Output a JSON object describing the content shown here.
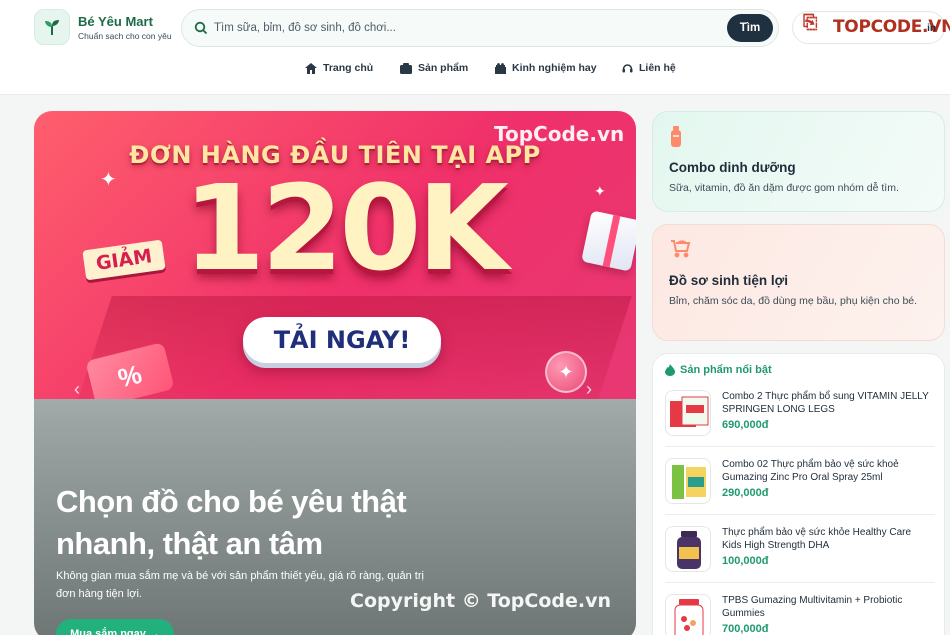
{
  "header": {
    "brand_name": "Bé Yêu Mart",
    "brand_tagline": "Chuẩn sạch cho con yêu",
    "search_placeholder": "Tìm sữa, bỉm, đồ sơ sinh, đồ chơi...",
    "search_button": "Tìm",
    "account_watermark_mark": "⎘",
    "account_watermark": "TOPCODE.VN",
    "account_label": "in"
  },
  "nav": [
    {
      "label": "Trang chủ",
      "icon": "home-icon"
    },
    {
      "label": "Sản phẩm",
      "icon": "box-icon"
    },
    {
      "label": "Kinh nghiệm hay",
      "icon": "gift-icon"
    },
    {
      "label": "Liên hệ",
      "icon": "headset-icon"
    }
  ],
  "banner": {
    "headline": "ĐƠN HÀNG ĐẦU TIÊN TẠI APP",
    "discount_tag": "GIẢM",
    "amount": "120K",
    "cta": "TẢI NGAY!",
    "watermark": "TopCode.vn",
    "percent_symbol": "%"
  },
  "hero": {
    "title": "Chọn đồ cho bé yêu thật nhanh, thật an tâm",
    "description": "Không gian mua sắm mẹ và bé với sản phẩm thiết yếu, giá rõ ràng, quản trị đơn hàng tiện lợi.",
    "button": "Mua sắm ngay →",
    "watermark": "Copyright © TopCode.vn"
  },
  "cards": [
    {
      "title": "Combo dinh dưỡng",
      "description": "Sữa, vitamin, đồ ăn dặm được gom nhóm dễ tìm.",
      "icon": "bottle-icon",
      "accent": "#ff8a6b"
    },
    {
      "title": "Đồ sơ sinh tiện lợi",
      "description": "Bỉm, chăm sóc da, đồ dùng mẹ bầu, phụ kiện cho bé.",
      "icon": "stroller-icon",
      "accent": "#ff8a6b"
    }
  ],
  "featured": {
    "heading": "Sản phẩm nổi bật",
    "products": [
      {
        "name": "Combo 2 Thực phẩm bổ sung VITAMIN JELLY SPRINGEN LONG LEGS",
        "price": "690,000đ"
      },
      {
        "name": "Combo 02 Thực phẩm bảo vệ sức khoẻ Gumazing Zinc Pro Oral Spray 25ml",
        "price": "290,000đ"
      },
      {
        "name": "Thực phẩm bảo vệ sức khỏe Healthy Care Kids High Strength DHA",
        "price": "100,000đ"
      },
      {
        "name": "TPBS Gumazing Multivitamin + Probiotic Gummies",
        "price": "700,000đ"
      }
    ]
  },
  "colors": {
    "brand_green": "#1c6b47",
    "accent_green": "#22b07d",
    "price_green": "#1f9a6d",
    "banner_pink": "#f0306a",
    "dark_button": "#1f3140"
  }
}
